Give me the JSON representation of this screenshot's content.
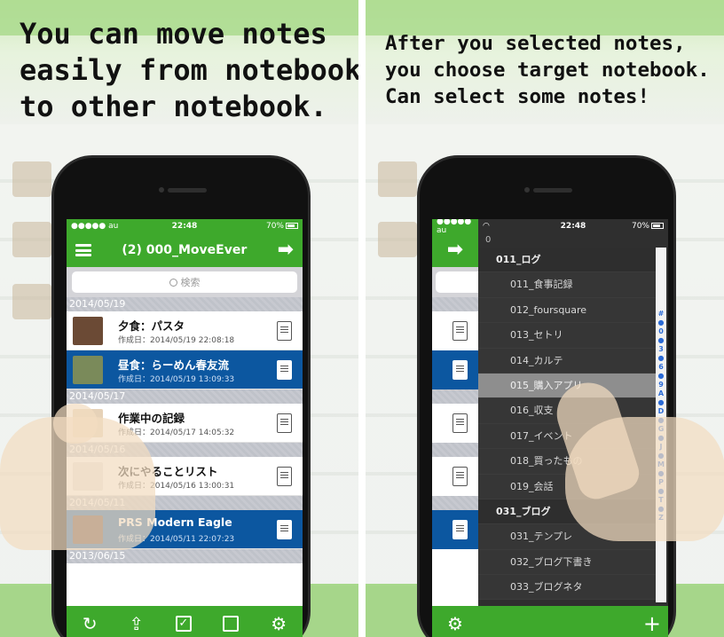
{
  "left": {
    "headline": "You can move notes\neasily from notebook\nto other notebook.",
    "status": {
      "carrier": "●●●●● au",
      "time": "22:48",
      "battery": "70%"
    },
    "navbar_title": "(2) 000_MoveEver",
    "search_placeholder": "検索",
    "sections": [
      {
        "date": "2014/05/19",
        "notes": [
          {
            "title": "夕食：パスタ",
            "date": "作成日：2014/05/19 22:08:18",
            "selected": false,
            "thumb": "#6b4a35"
          },
          {
            "title": "昼食：らーめん春友流",
            "date": "作成日：2014/05/19 13:09:33",
            "selected": true,
            "thumb": "#7a8a5a"
          }
        ]
      },
      {
        "date": "2014/05/17",
        "notes": [
          {
            "title": "作業中の記録",
            "date": "作成日：2014/05/17 14:05:32",
            "selected": false,
            "thumb": "#e6d2b8"
          }
        ]
      },
      {
        "date": "2014/05/16",
        "notes": [
          {
            "title": "次にやることリスト",
            "date": "作成日：2014/05/16 13:00:31",
            "selected": false,
            "thumb": "#e8e6e0"
          }
        ]
      },
      {
        "date": "2014/05/11",
        "notes": [
          {
            "title": "PRS Modern Eagle",
            "date": "作成日：2014/05/11 22:07:23",
            "selected": true,
            "thumb": "#5a3a30"
          }
        ]
      },
      {
        "date": "2013/06/15",
        "notes": []
      }
    ],
    "toolbar": {
      "sync": "↻",
      "share": "⇪",
      "check": "✓",
      "gear": "⚙"
    }
  },
  "right": {
    "headline": "After you selected notes,\nyou choose target notebook.\nCan select some notes!",
    "status": {
      "carrier": "●●●●● au",
      "time": "22:48",
      "battery": "70%"
    },
    "drawer_header": "0",
    "notebooks": [
      {
        "label": "011_ログ",
        "stack": true
      },
      {
        "label": "011_食事記録",
        "stack": false
      },
      {
        "label": "012_foursquare",
        "stack": false
      },
      {
        "label": "013_セトリ",
        "stack": false
      },
      {
        "label": "014_カルテ",
        "stack": false
      },
      {
        "label": "015_購入アプリ",
        "stack": false,
        "highlight": true
      },
      {
        "label": "016_収支",
        "stack": false
      },
      {
        "label": "017_イベント",
        "stack": false
      },
      {
        "label": "018_買ったもの",
        "stack": false
      },
      {
        "label": "019_会話",
        "stack": false
      },
      {
        "label": "031_ブログ",
        "stack": true
      },
      {
        "label": "031_テンプレ",
        "stack": false
      },
      {
        "label": "032_ブログ下書き",
        "stack": false
      },
      {
        "label": "033_ブログネタ",
        "stack": false
      }
    ],
    "index": [
      "#",
      "●",
      "0",
      "●",
      "3",
      "●",
      "6",
      "●",
      "9",
      "A",
      "●",
      "D",
      "●",
      "G",
      "●",
      "J",
      "●",
      "M",
      "●",
      "P",
      "●",
      "T",
      "●",
      "Z"
    ],
    "add_label": "+",
    "arrow": "➡",
    "gear": "⚙"
  }
}
